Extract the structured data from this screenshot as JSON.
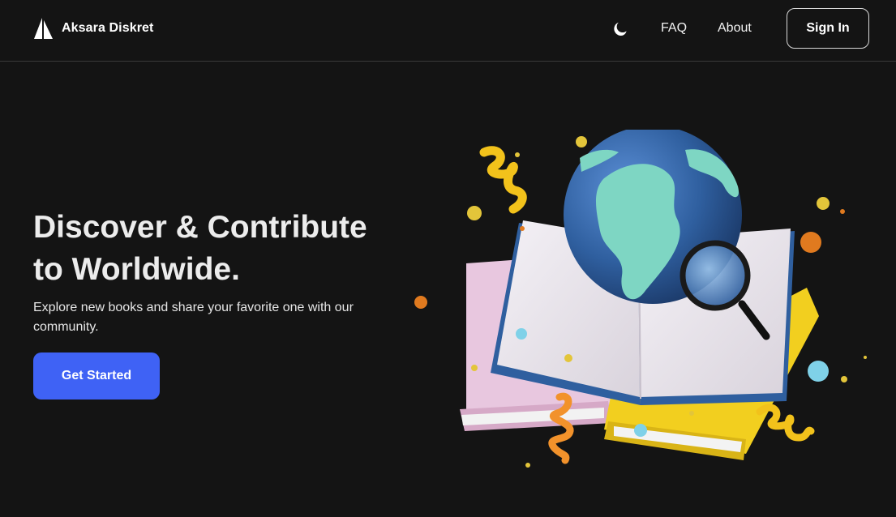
{
  "brand": {
    "name": "Aksara Diskret",
    "logo_icon": "sail-logo-icon"
  },
  "nav": {
    "theme_icon": "moon-icon",
    "links": [
      {
        "label": "FAQ"
      },
      {
        "label": "About"
      }
    ],
    "signin_label": "Sign In"
  },
  "hero": {
    "title_line1": "Discover & Contribute",
    "title_line2": "to Worldwide.",
    "description": "Explore new books and share your favorite one with our community.",
    "cta_label": "Get Started"
  },
  "colors": {
    "background": "#141414",
    "accent": "#3f62f5",
    "text": "#ececec",
    "border": "#3a3a3a"
  },
  "illustration": {
    "name": "books-globe-illustration"
  }
}
